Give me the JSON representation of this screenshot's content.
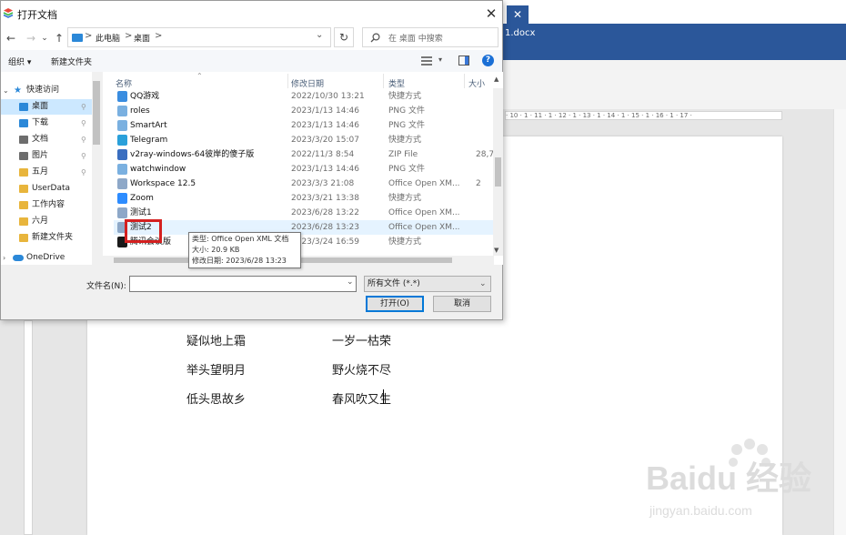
{
  "dialog": {
    "title": "打开文档",
    "close_glyph": "✕",
    "nav": {
      "back": "←",
      "forward": "→",
      "dropdown": "⌄",
      "up": "↑",
      "breadcrumb": [
        "此电脑",
        "桌面"
      ],
      "breadcrumb_sep": ">",
      "address_dropdown": "⌄",
      "refresh": "↻",
      "search_placeholder": "在 桌面 中搜索"
    },
    "toolbar": {
      "organize": "组织 ▾",
      "new_folder": "新建文件夹",
      "help": "?"
    },
    "sidebar": {
      "quick_access": "快速访问",
      "items": [
        {
          "label": "桌面",
          "icon": "desktop-icon",
          "color": "#2b88d8"
        },
        {
          "label": "下载",
          "icon": "download-icon",
          "color": "#2b88d8"
        },
        {
          "label": "文档",
          "icon": "document-icon",
          "color": "#6d6d6d"
        },
        {
          "label": "图片",
          "icon": "picture-icon",
          "color": "#6d6d6d"
        },
        {
          "label": "五月",
          "icon": "folder-icon",
          "color": "#e8b53c"
        },
        {
          "label": "UserData",
          "icon": "folder-icon",
          "color": "#e8b53c"
        },
        {
          "label": "工作内容",
          "icon": "folder-icon",
          "color": "#e8b53c"
        },
        {
          "label": "六月",
          "icon": "folder-icon",
          "color": "#e8b53c"
        },
        {
          "label": "新建文件夹",
          "icon": "folder-icon",
          "color": "#e8b53c"
        }
      ],
      "onedrive": "OneDrive"
    },
    "columns": {
      "name": "名称",
      "date": "修改日期",
      "type": "类型",
      "size": "大小"
    },
    "files": [
      {
        "name": "QQ游戏",
        "date": "2022/10/30 13:21",
        "type": "快捷方式",
        "size": "",
        "icon": "qq-game-icon",
        "color": "#3a8de0"
      },
      {
        "name": "roles",
        "date": "2023/1/13 14:46",
        "type": "PNG 文件",
        "size": "",
        "icon": "image-file-icon",
        "color": "#7ab0e0"
      },
      {
        "name": "SmartArt",
        "date": "2023/1/13 14:46",
        "type": "PNG 文件",
        "size": "",
        "icon": "image-file-icon",
        "color": "#7ab0e0"
      },
      {
        "name": "Telegram",
        "date": "2023/3/20 15:07",
        "type": "快捷方式",
        "size": "",
        "icon": "telegram-icon",
        "color": "#2aa0da"
      },
      {
        "name": "v2ray-windows-64彼岸的傻子版",
        "date": "2022/11/3 8:54",
        "type": "ZIP File",
        "size": "28,7(",
        "icon": "zip-icon",
        "color": "#3a6ec0"
      },
      {
        "name": "watchwindow",
        "date": "2023/1/13 14:46",
        "type": "PNG 文件",
        "size": "",
        "icon": "image-file-icon",
        "color": "#7ab0e0"
      },
      {
        "name": "Workspace 12.5",
        "date": "2023/3/3 21:08",
        "type": "Office Open XM...",
        "size": "2",
        "icon": "word-file-icon",
        "color": "#8ea8c8"
      },
      {
        "name": "Zoom",
        "date": "2023/3/21 13:38",
        "type": "快捷方式",
        "size": "",
        "icon": "zoom-icon",
        "color": "#2d8cff"
      },
      {
        "name": "测试1",
        "date": "2023/6/28 13:22",
        "type": "Office Open XM...",
        "size": "",
        "icon": "word-file-icon",
        "color": "#8ea8c8"
      },
      {
        "name": "测试2",
        "date": "2023/6/28 13:23",
        "type": "Office Open XM...",
        "size": "",
        "icon": "word-file-icon",
        "color": "#8ea8c8"
      },
      {
        "name": "腾讯会议版",
        "date": "2023/3/24 16:59",
        "type": "快捷方式",
        "size": "",
        "icon": "app-shortcut-icon",
        "color": "#1a1a1a"
      }
    ],
    "tooltip": {
      "type_line": "类型: Office Open XML 文档",
      "size_line": "大小: 20.9 KB",
      "date_line": "修改日期: 2023/6/28 13:23"
    },
    "filename_label": "文件名(N):",
    "filename_value": "",
    "filter": "所有文件 (*.*)",
    "open_button": "打开(O)",
    "cancel_button": "取消"
  },
  "word": {
    "tab_close": "✕",
    "filename": "1.docx",
    "ruler_text": "· 10 · 1 · 11 · 1 · 12 · 1 · 13 · 1 · 14 · 1 · 15 · 1 · 16 · 1 · 17 ·",
    "poem_left": [
      "疑似地上霜",
      "举头望明月",
      "低头思故乡"
    ],
    "poem_right": [
      "一岁一枯荣",
      "野火烧不尽",
      "春风吹又生"
    ]
  },
  "watermark": {
    "brand": "Baidu 经验",
    "url": "jingyan.baidu.com"
  }
}
